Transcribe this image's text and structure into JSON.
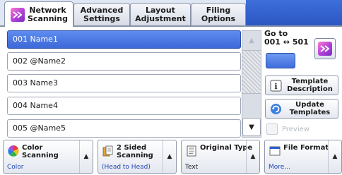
{
  "tabs": [
    {
      "label": "Network\nScanning",
      "active": true
    },
    {
      "label": "Advanced\nSettings",
      "active": false
    },
    {
      "label": "Layout\nAdjustment",
      "active": false
    },
    {
      "label": "Filing Options",
      "active": false
    }
  ],
  "address_list": [
    {
      "text": "001  Name1",
      "selected": true
    },
    {
      "text": "002  @Name2",
      "selected": false
    },
    {
      "text": "003  Name3",
      "selected": false
    },
    {
      "text": "004  Name4",
      "selected": false
    },
    {
      "text": "005  @Name5",
      "selected": false
    }
  ],
  "scroll": {
    "up_glyph": "▲",
    "down_glyph": "▼"
  },
  "goto": {
    "label": "Go to\n001 ↔ 501",
    "input_value": ""
  },
  "side_buttons": {
    "template_description": "Template\nDescription",
    "update_templates": "Update\nTemplates",
    "preview": "Preview"
  },
  "features": [
    {
      "title": "Color\nScanning",
      "value": "Color",
      "icon": "color-wheel-icon"
    },
    {
      "title": "2 Sided\nScanning",
      "value": "(Head to Head)",
      "icon": "two-sided-icon"
    },
    {
      "title": "Original Type",
      "value": "Text",
      "icon": "document-icon"
    },
    {
      "title": "File Format",
      "value": "More...",
      "icon": "file-format-icon"
    }
  ],
  "colors": {
    "accent": "#3d68d8",
    "tab_fill": "#2b56c2",
    "value_text": "#2346b6"
  }
}
